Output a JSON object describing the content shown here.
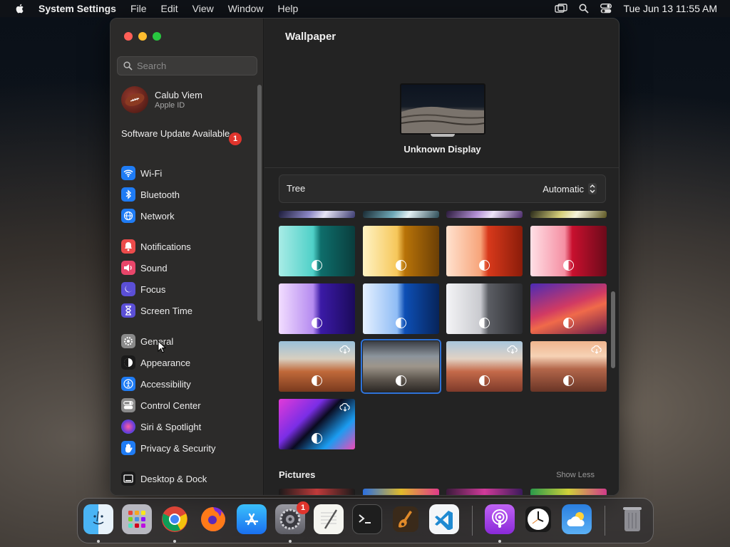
{
  "menubar": {
    "app_name": "System Settings",
    "menus": [
      "File",
      "Edit",
      "View",
      "Window",
      "Help"
    ],
    "clock": "Tue Jun 13  11:55 AM"
  },
  "sidebar": {
    "search_placeholder": "Search",
    "profile": {
      "name": "Calub Viem",
      "subtitle": "Apple ID"
    },
    "update": {
      "label": "Software Update Available",
      "count": "1"
    },
    "items": [
      {
        "label": "Wi-Fi",
        "icon": "wifi-icon",
        "color": "#1f7cf5"
      },
      {
        "label": "Bluetooth",
        "icon": "bluetooth-icon",
        "color": "#1f7cf5"
      },
      {
        "label": "Network",
        "icon": "globe-icon",
        "color": "#1f7cf5"
      },
      {
        "label": "Notifications",
        "icon": "bell-icon",
        "color": "#ec4b4b"
      },
      {
        "label": "Sound",
        "icon": "speaker-icon",
        "color": "#e8466a"
      },
      {
        "label": "Focus",
        "icon": "moon-icon",
        "color": "#5b4fd6"
      },
      {
        "label": "Screen Time",
        "icon": "hourglass-icon",
        "color": "#5b4fd6"
      },
      {
        "label": "General",
        "icon": "gear-icon",
        "color": "#8a8a8a"
      },
      {
        "label": "Appearance",
        "icon": "appearance-icon",
        "color": "#1a1a1a"
      },
      {
        "label": "Accessibility",
        "icon": "accessibility-icon",
        "color": "#1f7cf5"
      },
      {
        "label": "Control Center",
        "icon": "control-center-icon",
        "color": "#8a8a8a"
      },
      {
        "label": "Siri & Spotlight",
        "icon": "siri-icon",
        "color": "#b04ad8"
      },
      {
        "label": "Privacy & Security",
        "icon": "hand-icon",
        "color": "#1f7cf5"
      },
      {
        "label": "Desktop & Dock",
        "icon": "desktop-icon",
        "color": "#1a1a1a"
      }
    ]
  },
  "main": {
    "title": "Wallpaper",
    "display_label": "Unknown Display",
    "picker": {
      "selection": "Tree",
      "mode": "Automatic"
    },
    "pictures_title": "Pictures",
    "show_less": "Show Less"
  },
  "dock": {
    "settings_badge": "1",
    "apps": [
      "finder",
      "launchpad",
      "chrome",
      "firefox",
      "app-store",
      "system-settings",
      "textedit",
      "terminal",
      "garageband",
      "vscode",
      "podcasts",
      "clock",
      "weather",
      "trash"
    ]
  }
}
